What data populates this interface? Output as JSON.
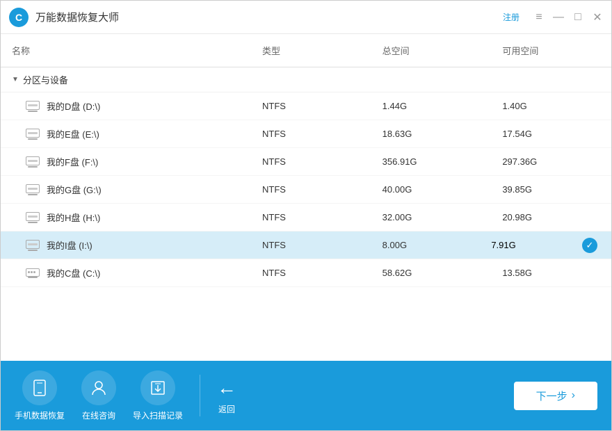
{
  "window": {
    "title": "万能数据恢复大师",
    "logo_text": "C",
    "register_label": "注册"
  },
  "controls": {
    "minimize": "—",
    "maximize": "□",
    "close": "✕",
    "menu": "≡"
  },
  "table": {
    "headers": [
      "名称",
      "类型",
      "总空间",
      "可用空间"
    ],
    "section_label": "分区与设备",
    "rows": [
      {
        "name": "我的D盘 (D:\\)",
        "type": "NTFS",
        "total": "1.44G",
        "free": "1.40G",
        "icon": "partition",
        "selected": false
      },
      {
        "name": "我的E盘 (E:\\)",
        "type": "NTFS",
        "total": "18.63G",
        "free": "17.54G",
        "icon": "partition",
        "selected": false
      },
      {
        "name": "我的F盘 (F:\\)",
        "type": "NTFS",
        "total": "356.91G",
        "free": "297.36G",
        "icon": "partition",
        "selected": false
      },
      {
        "name": "我的G盘 (G:\\)",
        "type": "NTFS",
        "total": "40.00G",
        "free": "39.85G",
        "icon": "partition",
        "selected": false
      },
      {
        "name": "我的H盘 (H:\\)",
        "type": "NTFS",
        "total": "32.00G",
        "free": "20.98G",
        "icon": "partition",
        "selected": false
      },
      {
        "name": "我的I盘 (I:\\)",
        "type": "NTFS",
        "total": "8.00G",
        "free": "7.91G",
        "icon": "partition",
        "selected": true
      },
      {
        "name": "我的C盘 (C:\\)",
        "type": "NTFS",
        "total": "58.62G",
        "free": "13.58G",
        "icon": "cdrive",
        "selected": false
      }
    ]
  },
  "toolbar": {
    "btn1_label": "手机数据恢复",
    "btn2_label": "在线咨询",
    "btn3_label": "导入扫描记录",
    "back_label": "返回",
    "next_label": "下一步"
  }
}
